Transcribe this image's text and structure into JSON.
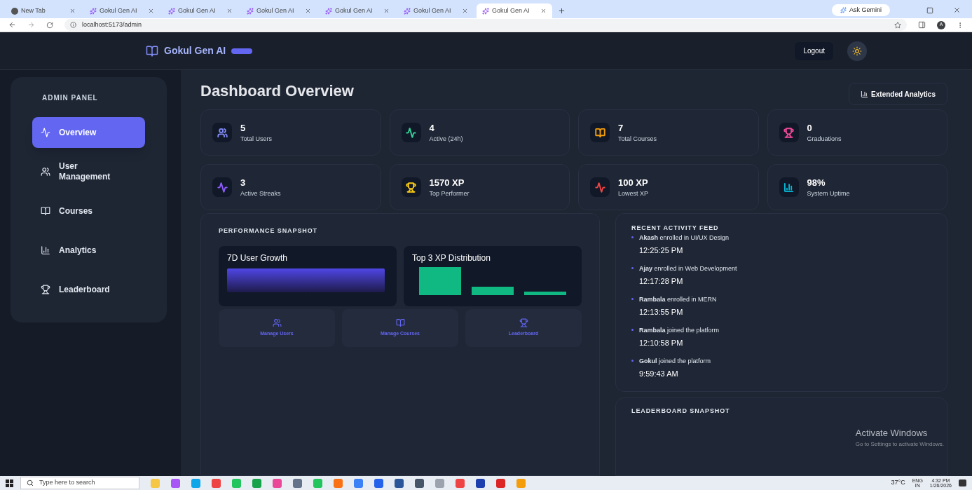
{
  "browser": {
    "tabs": [
      {
        "title": "New Tab",
        "selected": false,
        "kind": "newtab"
      },
      {
        "title": "Gokul Gen AI",
        "selected": false,
        "kind": "site"
      },
      {
        "title": "Gokul Gen AI",
        "selected": false,
        "kind": "site"
      },
      {
        "title": "Gokul Gen AI",
        "selected": false,
        "kind": "site"
      },
      {
        "title": "Gokul Gen AI",
        "selected": false,
        "kind": "site"
      },
      {
        "title": "Gokul Gen AI",
        "selected": false,
        "kind": "site"
      },
      {
        "title": "Gokul Gen AI",
        "selected": true,
        "kind": "site"
      }
    ],
    "gemini": "Ask Gemini",
    "url": "localhost:5173/admin",
    "profile": "A"
  },
  "header": {
    "brand": "Gokul Gen AI",
    "logout": "Logout"
  },
  "sidebar": {
    "title": "ADMIN PANEL",
    "items": [
      {
        "label": "Overview",
        "kind": "activity",
        "selected": true
      },
      {
        "label": "User Management",
        "kind": "users",
        "selected": false
      },
      {
        "label": "Courses",
        "kind": "book",
        "selected": false
      },
      {
        "label": "Analytics",
        "kind": "chart",
        "selected": false
      },
      {
        "label": "Leaderboard",
        "kind": "trophy",
        "selected": false
      }
    ]
  },
  "page": {
    "title": "Dashboard Overview",
    "extended": "Extended Analytics"
  },
  "stats": [
    {
      "value": "5",
      "label": "Total Users",
      "kind": "users",
      "color": "#818cf8"
    },
    {
      "value": "4",
      "label": "Active (24h)",
      "kind": "activity",
      "color": "#34d399"
    },
    {
      "value": "7",
      "label": "Total Courses",
      "kind": "book",
      "color": "#f59e0b"
    },
    {
      "value": "0",
      "label": "Graduations",
      "kind": "trophy",
      "color": "#ec4899"
    },
    {
      "value": "3",
      "label": "Active Streaks",
      "kind": "activity",
      "color": "#8b5cf6"
    },
    {
      "value": "1570 XP",
      "label": "Top Performer",
      "kind": "trophy",
      "color": "#facc15"
    },
    {
      "value": "100 XP",
      "label": "Lowest XP",
      "kind": "activity",
      "color": "#ef4444"
    },
    {
      "value": "98%",
      "label": "System Uptime",
      "kind": "chart",
      "color": "#06b6d4"
    }
  ],
  "performance": {
    "title": "PERFORMANCE SNAPSHOT",
    "growth": "7D User Growth",
    "distribution": "Top 3 XP Distribution",
    "actions": [
      {
        "label": "Manage Users",
        "kind": "users"
      },
      {
        "label": "Manage Courses",
        "kind": "book"
      },
      {
        "label": "Leaderboard",
        "kind": "trophy"
      }
    ]
  },
  "activity": {
    "title": "RECENT ACTIVITY FEED",
    "items": [
      {
        "text": "**Akash** enrolled in UI/UX Design",
        "time": "12:25:25 PM"
      },
      {
        "text": "**Ajay** enrolled in Web Development",
        "time": "12:17:28 PM"
      },
      {
        "text": "**Rambala** enrolled in MERN",
        "time": "12:13:55 PM"
      },
      {
        "text": "**Rambala** joined the platform",
        "time": "12:10:58 PM"
      },
      {
        "text": "**Gokul** joined the platform",
        "time": "9:59:43 AM"
      }
    ]
  },
  "leaderboard": {
    "title": "LEADERBOARD SNAPSHOT"
  },
  "watermark": {
    "title": "Activate Windows",
    "hint": "Go to Settings to activate Windows."
  },
  "taskbar": {
    "search": "Type here to search",
    "weather": "37°C",
    "lang": "ENG",
    "region": "IN",
    "time": "4:32 PM",
    "date": "1/26/2026"
  }
}
